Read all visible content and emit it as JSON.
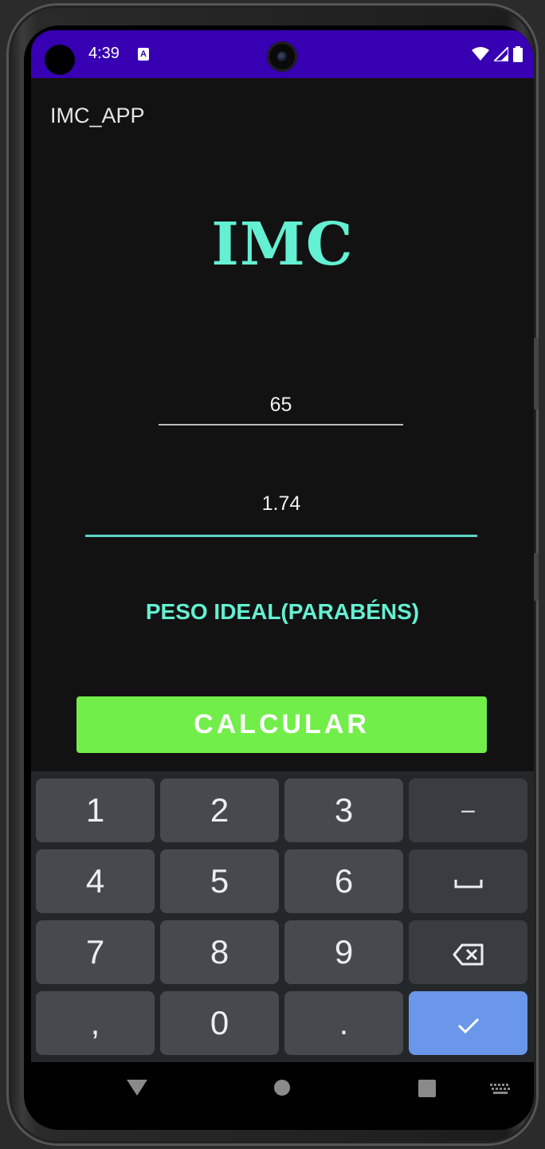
{
  "status_bar": {
    "time": "4:39",
    "notification_icon": "a-icon",
    "icons": [
      "wifi-icon",
      "signal-icon",
      "battery-icon"
    ]
  },
  "app_bar": {
    "title": "IMC_APP"
  },
  "main": {
    "heading": "IMC",
    "weight_input": {
      "value": "65"
    },
    "height_input": {
      "value": "1.74"
    },
    "result_text": "PESO IDEAL(PARABÉNS)",
    "calculate_button": "CALCULAR"
  },
  "keyboard": {
    "keys": [
      [
        "1",
        "2",
        "3",
        "–"
      ],
      [
        "4",
        "5",
        "6",
        "space-icon"
      ],
      [
        "7",
        "8",
        "9",
        "backspace-icon"
      ],
      [
        ",",
        "0",
        ".",
        "check-icon"
      ]
    ],
    "row1": {
      "k1": "1",
      "k2": "2",
      "k3": "3",
      "k4": "–"
    },
    "row2": {
      "k1": "4",
      "k2": "5",
      "k3": "6"
    },
    "row3": {
      "k1": "7",
      "k2": "8",
      "k3": "9"
    },
    "row4": {
      "k1": ",",
      "k2": "0",
      "k3": "."
    }
  },
  "navigation_bar": {
    "buttons": [
      "back-icon",
      "home-icon",
      "recents-icon",
      "keyboard-switch-icon"
    ]
  },
  "colors": {
    "status_bar": "#3700b3",
    "accent": "#64f0d2",
    "button": "#72ee4a",
    "enter_key": "#6a97ea",
    "background": "#121212"
  }
}
